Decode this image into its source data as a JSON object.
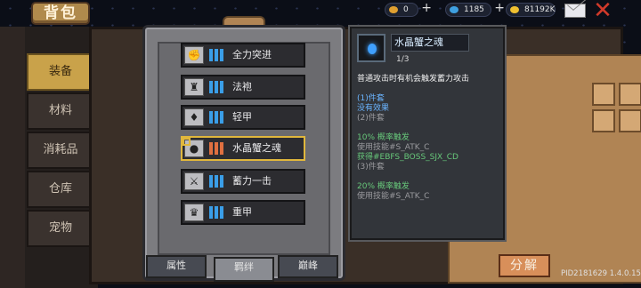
{
  "header": {
    "title": "背包",
    "resources": [
      {
        "value": "0",
        "color": "#e0a030",
        "icon": "coin-icon"
      },
      {
        "value": "1185",
        "color": "#3fa0e0",
        "icon": "gem-icon"
      },
      {
        "value": "81192K",
        "color": "#f0c030",
        "icon": "gold-icon"
      }
    ],
    "plus": "+",
    "close": "✕"
  },
  "sidebar": {
    "items": [
      {
        "label": "装备"
      },
      {
        "label": "材料"
      },
      {
        "label": "消耗品"
      },
      {
        "label": "仓库"
      },
      {
        "label": "宠物"
      }
    ]
  },
  "list": {
    "rows": [
      {
        "label": "全力突进",
        "icon": "fist-icon",
        "bar_color": "#3a9ee8"
      },
      {
        "label": "法袍",
        "icon": "robe-icon",
        "bar_color": "#3a9ee8"
      },
      {
        "label": "轻甲",
        "icon": "armor-icon",
        "bar_color": "#3a9ee8"
      },
      {
        "label": "水晶蟹之魂",
        "icon": "soul-icon",
        "bar_color": "#e07040"
      },
      {
        "label": "蓄力一击",
        "icon": "strike-icon",
        "bar_color": "#3a9ee8"
      },
      {
        "label": "重甲",
        "icon": "heavy-armor-icon",
        "bar_color": "#3a9ee8"
      }
    ]
  },
  "tabs": [
    {
      "label": "属性"
    },
    {
      "label": "羁绊"
    },
    {
      "label": "巅峰"
    }
  ],
  "tooltip": {
    "name": "水晶蟹之魂",
    "count": "1/3",
    "description": "普通攻击时有机会触发蓄力攻击",
    "set1": [
      "(1)件套",
      "没有效果",
      "(2)件套"
    ],
    "set2": [
      "10% 概率触发",
      "使用技能#S_ATK_C",
      "获得#EBFS_BOSS_SJX_CD",
      "(3)件套"
    ],
    "set3": [
      "20% 概率触发",
      "使用技能#S_ATK_C"
    ]
  },
  "actions": {
    "decompose": "分解"
  },
  "footer": {
    "pid": "PID2181629 1.4.0.15"
  }
}
